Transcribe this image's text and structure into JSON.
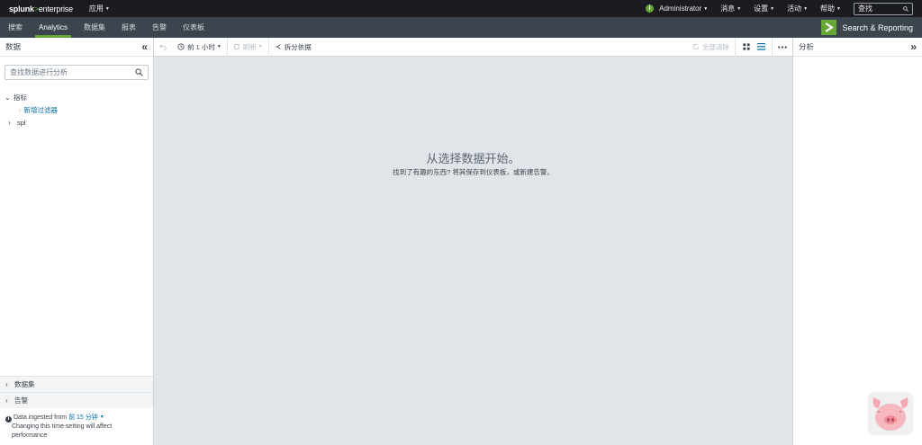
{
  "topbar": {
    "logo_main": "splunk",
    "logo_gt": ">",
    "logo_sub": "enterprise",
    "app_menu": "应用",
    "status_icon_glyph": "i",
    "user_menu": "Administrator",
    "messages_menu": "消息",
    "settings_menu": "设置",
    "activity_menu": "活动",
    "help_menu": "帮助",
    "find_placeholder": "查找"
  },
  "appbar": {
    "tabs": [
      {
        "label": "搜索"
      },
      {
        "label": "Analytics",
        "active": true
      },
      {
        "label": "数据集"
      },
      {
        "label": "报表"
      },
      {
        "label": "告警"
      },
      {
        "label": "仪表板"
      }
    ],
    "brand_name": "Search & Reporting"
  },
  "left_panel": {
    "title": "数据",
    "search_placeholder": "查找数据进行分析",
    "tree": {
      "root_label": "指标",
      "add_filter": "新增过滤器",
      "child_label": "spl"
    },
    "sections": [
      {
        "label": "数据集"
      },
      {
        "label": "告警"
      }
    ],
    "ingest": {
      "prefix": "Data ingested from",
      "time_link": "前 15 分钟",
      "line2": "Changing this time setting will affect",
      "line3": "performance"
    }
  },
  "toolbar": {
    "time_range": "前 1 小时",
    "refresh": "刷新",
    "split_by": "拆分依据",
    "clear_all": "全部清除"
  },
  "main": {
    "empty_title": "从选择数据开始。",
    "empty_sub": "找到了有趣的东西? 将其保存到仪表板，或新建告警。"
  },
  "right_panel": {
    "title": "分析"
  },
  "colors": {
    "topbar_bg": "#1a1c21",
    "appbar_bg": "#3c444d",
    "accent_green": "#65a637",
    "link_blue": "#006eaa",
    "canvas_bg": "#e1e5e9"
  }
}
